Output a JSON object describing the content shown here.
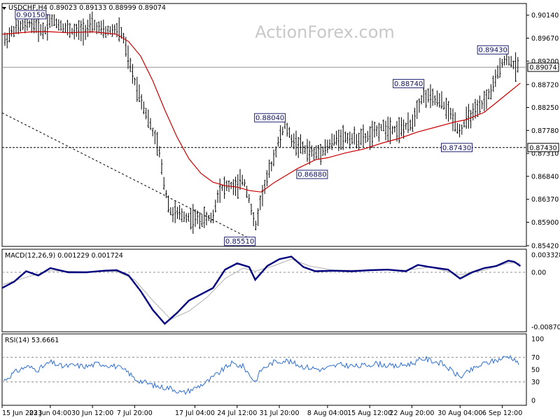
{
  "title": "USDCHF,H4",
  "ohlc_header": "0.89023 0.89133 0.88999 0.89074",
  "watermark": "ActionForex.com",
  "colors": {
    "background": "#ffffff",
    "price_bars": "#000000",
    "moving_average": "#cc0000",
    "macd_line": "#00007f",
    "macd_signal": "#b0b0b0",
    "rsi_line": "#3070d0",
    "frame": "#000000",
    "dotted_levels": "#909090",
    "annotation_box": "#202070"
  },
  "chart_data": [
    {
      "type": "line",
      "panel": "price",
      "title": "USDCHF,H4 0.89023 0.89133 0.88999 0.89074",
      "ylim": [
        0.8542,
        0.9015
      ],
      "y_ticks": [
        "0.90140",
        "0.89670",
        "0.89200",
        "0.88720",
        "0.88250",
        "0.87780",
        "0.87310",
        "0.86840",
        "0.86370",
        "0.85900",
        "0.85420"
      ],
      "current_price_label": "0.89074",
      "current_price": 0.89074,
      "horizontal_level_label": "0.87430",
      "horizontal_level": 0.8743,
      "x_tick_labels": [
        "15 Jun 2023",
        "23 Jun 04:00",
        "30 Jun 12:00",
        "7 Jul 20:00",
        "17 Jul 04:00",
        "24 Jul 12:00",
        "31 Jul 20:00",
        "8 Aug 04:00",
        "15 Aug 12:00",
        "22 Aug 20:00",
        "30 Aug 04:00",
        "6 Sep 12:00"
      ],
      "annotations": [
        {
          "label": "0.90150",
          "at": "23 Jun 2023",
          "value": 0.9015
        },
        {
          "label": "0.85510",
          "at": "27 Jul 2023",
          "value": 0.8551
        },
        {
          "label": "0.88040",
          "at": "1 Aug 2023",
          "value": 0.8804
        },
        {
          "label": "0.86880",
          "at": "8 Aug 2023",
          "value": 0.8688
        },
        {
          "label": "0.88740",
          "at": "24 Aug 2023",
          "value": 0.8874
        },
        {
          "label": "0.87430",
          "at": "1 Sep 2023",
          "value": 0.8743
        },
        {
          "label": "0.89430",
          "at": "7 Sep 2023",
          "value": 0.8943
        }
      ],
      "price_path": [
        [
          "15 Jun 2023",
          0.8955
        ],
        [
          "17 Jun 2023",
          0.8985
        ],
        [
          "20 Jun 2023",
          0.9
        ],
        [
          "22 Jun 2023",
          0.898
        ],
        [
          "23 Jun 2023",
          0.9005
        ],
        [
          "26 Jun 2023",
          0.8985
        ],
        [
          "27 Jun 2023",
          0.898
        ],
        [
          "29 Jun 2023",
          0.8985
        ],
        [
          "30 Jun 2023",
          0.8995
        ],
        [
          "2 Jul 2023",
          0.898
        ],
        [
          "4 Jul 2023",
          0.8985
        ],
        [
          "5 Jul 2023",
          0.8975
        ],
        [
          "6 Jul 2023",
          0.892
        ],
        [
          "7 Jul 2023",
          0.888
        ],
        [
          "9 Jul 2023",
          0.881
        ],
        [
          "11 Jul 2023",
          0.874
        ],
        [
          "12 Jul 2023",
          0.866
        ],
        [
          "13 Jul 2023",
          0.861
        ],
        [
          "16 Jul 2023",
          0.86
        ],
        [
          "18 Jul 2023",
          0.8595
        ],
        [
          "20 Jul 2023",
          0.86
        ],
        [
          "21 Jul 2023",
          0.866
        ],
        [
          "23 Jul 2023",
          0.8665
        ],
        [
          "24 Jul 2023",
          0.866
        ],
        [
          "25 Jul 2023",
          0.868
        ],
        [
          "26 Jul 2023",
          0.864
        ],
        [
          "27 Jul 2023",
          0.8575
        ],
        [
          "28 Jul 2023",
          0.864
        ],
        [
          "30 Jul 2023",
          0.872
        ],
        [
          "31 Jul 2023",
          0.876
        ],
        [
          "1 Aug 2023",
          0.879
        ],
        [
          "2 Aug 2023",
          0.876
        ],
        [
          "4 Aug 2023",
          0.874
        ],
        [
          "6 Aug 2023",
          0.873
        ],
        [
          "8 Aug 2023",
          0.8745
        ],
        [
          "10 Aug 2023",
          0.8765
        ],
        [
          "13 Aug 2023",
          0.876
        ],
        [
          "15 Aug 2023",
          0.8765
        ],
        [
          "17 Aug 2023",
          0.8785
        ],
        [
          "20 Aug 2023",
          0.878
        ],
        [
          "22 Aug 2023",
          0.879
        ],
        [
          "23 Aug 2023",
          0.883
        ],
        [
          "24 Aug 2023",
          0.885
        ],
        [
          "27 Aug 2023",
          0.8835
        ],
        [
          "29 Aug 2023",
          0.88
        ],
        [
          "30 Aug 2023",
          0.8775
        ],
        [
          "31 Aug 2023",
          0.88
        ],
        [
          "2 Sep 2023",
          0.882
        ],
        [
          "4 Sep 2023",
          0.8855
        ],
        [
          "5 Sep 2023",
          0.8885
        ],
        [
          "6 Sep 2023",
          0.892
        ],
        [
          "7 Sep 2023",
          0.8925
        ],
        [
          "8 Sep 2023",
          0.891
        ],
        [
          "9 Sep 2023",
          0.8907
        ]
      ],
      "moving_average_path": [
        [
          "15 Jun 2023",
          0.8975
        ],
        [
          "20 Jun 2023",
          0.898
        ],
        [
          "23 Jun 2023",
          0.898
        ],
        [
          "26 Jun 2023",
          0.8978
        ],
        [
          "30 Jun 2023",
          0.898
        ],
        [
          "4 Jul 2023",
          0.8975
        ],
        [
          "6 Jul 2023",
          0.896
        ],
        [
          "8 Jul 2023",
          0.893
        ],
        [
          "10 Jul 2023",
          0.888
        ],
        [
          "12 Jul 2023",
          0.882
        ],
        [
          "14 Jul 2023",
          0.8765
        ],
        [
          "16 Jul 2023",
          0.872
        ],
        [
          "18 Jul 2023",
          0.869
        ],
        [
          "20 Jul 2023",
          0.8672
        ],
        [
          "22 Jul 2023",
          0.8665
        ],
        [
          "24 Jul 2023",
          0.8662
        ],
        [
          "26 Jul 2023",
          0.8655
        ],
        [
          "28 Jul 2023",
          0.8652
        ],
        [
          "30 Jul 2023",
          0.867
        ],
        [
          "1 Aug 2023",
          0.8685
        ],
        [
          "3 Aug 2023",
          0.87
        ],
        [
          "6 Aug 2023",
          0.8718
        ],
        [
          "8 Aug 2023",
          0.8722
        ],
        [
          "11 Aug 2023",
          0.8732
        ],
        [
          "14 Aug 2023",
          0.874
        ],
        [
          "17 Aug 2023",
          0.8752
        ],
        [
          "20 Aug 2023",
          0.8762
        ],
        [
          "23 Aug 2023",
          0.8775
        ],
        [
          "26 Aug 2023",
          0.8785
        ],
        [
          "29 Aug 2023",
          0.8795
        ],
        [
          "31 Aug 2023",
          0.88
        ],
        [
          "3 Sep 2023",
          0.8815
        ],
        [
          "5 Sep 2023",
          0.8835
        ],
        [
          "7 Sep 2023",
          0.8855
        ],
        [
          "9 Sep 2023",
          0.8875
        ]
      ]
    },
    {
      "type": "line",
      "panel": "macd",
      "title": "MACD(12,26,9) 0.001229 0.001724",
      "ylim": [
        -0.008707,
        0.003328
      ],
      "y_ticks": [
        "0.003328",
        "0.00",
        "-0.008707"
      ],
      "series": [
        {
          "values": [
            [
              "15 Jun 2023",
              -0.0025
            ],
            [
              "17 Jun 2023",
              -0.0015
            ],
            [
              "19 Jun 2023",
              0.0002
            ],
            [
              "21 Jun 2023",
              -0.0005
            ],
            [
              "23 Jun 2023",
              0.0008
            ],
            [
              "26 Jun 2023",
              0.0
            ],
            [
              "29 Jun 2023",
              0.0
            ],
            [
              "2 Jul 2023",
              0.0003
            ],
            [
              "4 Jul 2023",
              0.0004
            ],
            [
              "6 Jul 2023",
              -0.0005
            ],
            [
              "8 Jul 2023",
              -0.003
            ],
            [
              "10 Jul 2023",
              -0.006
            ],
            [
              "12 Jul 2023",
              -0.0082
            ],
            [
              "14 Jul 2023",
              -0.0065
            ],
            [
              "16 Jul 2023",
              -0.0045
            ],
            [
              "18 Jul 2023",
              -0.0035
            ],
            [
              "20 Jul 2023",
              -0.0025
            ],
            [
              "22 Jul 2023",
              0.0005
            ],
            [
              "24 Jul 2023",
              0.0017
            ],
            [
              "26 Jul 2023",
              0.001
            ],
            [
              "27 Jul 2023",
              -0.0012
            ],
            [
              "29 Jul 2023",
              0.0012
            ],
            [
              "31 Jul 2023",
              0.0025
            ],
            [
              "2 Aug 2023",
              0.003
            ],
            [
              "4 Aug 2023",
              0.001
            ],
            [
              "6 Aug 2023",
              0.0002
            ],
            [
              "9 Aug 2023",
              0.0003
            ],
            [
              "12 Aug 2023",
              0.0002
            ],
            [
              "15 Aug 2023",
              0.0004
            ],
            [
              "18 Aug 2023",
              0.0005
            ],
            [
              "21 Aug 2023",
              0.0002
            ],
            [
              "23 Aug 2023",
              0.0014
            ],
            [
              "25 Aug 2023",
              0.001
            ],
            [
              "28 Aug 2023",
              0.0005
            ],
            [
              "30 Aug 2023",
              -0.001
            ],
            [
              "1 Sep 2023",
              0.0
            ],
            [
              "3 Sep 2023",
              0.0008
            ],
            [
              "5 Sep 2023",
              0.0012
            ],
            [
              "7 Sep 2023",
              0.0022
            ],
            [
              "8 Sep 2023",
              0.002
            ],
            [
              "9 Sep 2023",
              0.0012
            ]
          ]
        },
        {
          "values": [
            [
              "15 Jun 2023",
              -0.002
            ],
            [
              "19 Jun 2023",
              -0.0008
            ],
            [
              "23 Jun 2023",
              0.0003
            ],
            [
              "29 Jun 2023",
              0.0001
            ],
            [
              "4 Jul 2023",
              0.0002
            ],
            [
              "7 Jul 2023",
              -0.0012
            ],
            [
              "10 Jul 2023",
              -0.0045
            ],
            [
              "13 Jul 2023",
              -0.0075
            ],
            [
              "16 Jul 2023",
              -0.0062
            ],
            [
              "19 Jul 2023",
              -0.004
            ],
            [
              "22 Jul 2023",
              -0.001
            ],
            [
              "25 Jul 2023",
              0.0008
            ],
            [
              "27 Jul 2023",
              0.0002
            ],
            [
              "30 Jul 2023",
              0.0012
            ],
            [
              "2 Aug 2023",
              0.0025
            ],
            [
              "5 Aug 2023",
              0.0012
            ],
            [
              "9 Aug 2023",
              0.0004
            ],
            [
              "15 Aug 2023",
              0.0004
            ],
            [
              "21 Aug 2023",
              0.0004
            ],
            [
              "25 Aug 2023",
              0.001
            ],
            [
              "30 Aug 2023",
              -0.0004
            ],
            [
              "3 Sep 2023",
              0.0004
            ],
            [
              "7 Sep 2023",
              0.0018
            ],
            [
              "9 Sep 2023",
              0.0017
            ]
          ]
        }
      ]
    },
    {
      "type": "line",
      "panel": "rsi",
      "title": "RSI(14) 53.6661",
      "ylim": [
        0,
        100
      ],
      "y_ticks": [
        "100",
        "70",
        "50",
        "30",
        "0"
      ],
      "levels": [
        70,
        30
      ],
      "values": [
        [
          "15 Jun 2023",
          30
        ],
        [
          "17 Jun 2023",
          45
        ],
        [
          "19 Jun 2023",
          55
        ],
        [
          "21 Jun 2023",
          50
        ],
        [
          "23 Jun 2023",
          62
        ],
        [
          "25 Jun 2023",
          55
        ],
        [
          "27 Jun 2023",
          57
        ],
        [
          "29 Jun 2023",
          55
        ],
        [
          "1 Jul 2023",
          60
        ],
        [
          "4 Jul 2023",
          55
        ],
        [
          "6 Jul 2023",
          45
        ],
        [
          "7 Jul 2023",
          35
        ],
        [
          "9 Jul 2023",
          28
        ],
        [
          "11 Jul 2023",
          22
        ],
        [
          "13 Jul 2023",
          20
        ],
        [
          "15 Jul 2023",
          12
        ],
        [
          "17 Jul 2023",
          20
        ],
        [
          "19 Jul 2023",
          30
        ],
        [
          "21 Jul 2023",
          45
        ],
        [
          "23 Jul 2023",
          60
        ],
        [
          "25 Jul 2023",
          55
        ],
        [
          "27 Jul 2023",
          30
        ],
        [
          "28 Jul 2023",
          50
        ],
        [
          "30 Jul 2023",
          62
        ],
        [
          "1 Aug 2023",
          65
        ],
        [
          "4 Aug 2023",
          55
        ],
        [
          "7 Aug 2023",
          50
        ],
        [
          "10 Aug 2023",
          58
        ],
        [
          "13 Aug 2023",
          55
        ],
        [
          "16 Aug 2023",
          60
        ],
        [
          "19 Aug 2023",
          55
        ],
        [
          "22 Aug 2023",
          60
        ],
        [
          "24 Aug 2023",
          68
        ],
        [
          "27 Aug 2023",
          60
        ],
        [
          "29 Aug 2023",
          45
        ],
        [
          "30 Aug 2023",
          38
        ],
        [
          "1 Sep 2023",
          50
        ],
        [
          "3 Sep 2023",
          60
        ],
        [
          "5 Sep 2023",
          65
        ],
        [
          "7 Sep 2023",
          72
        ],
        [
          "8 Sep 2023",
          68
        ],
        [
          "9 Sep 2023",
          54
        ]
      ]
    }
  ]
}
